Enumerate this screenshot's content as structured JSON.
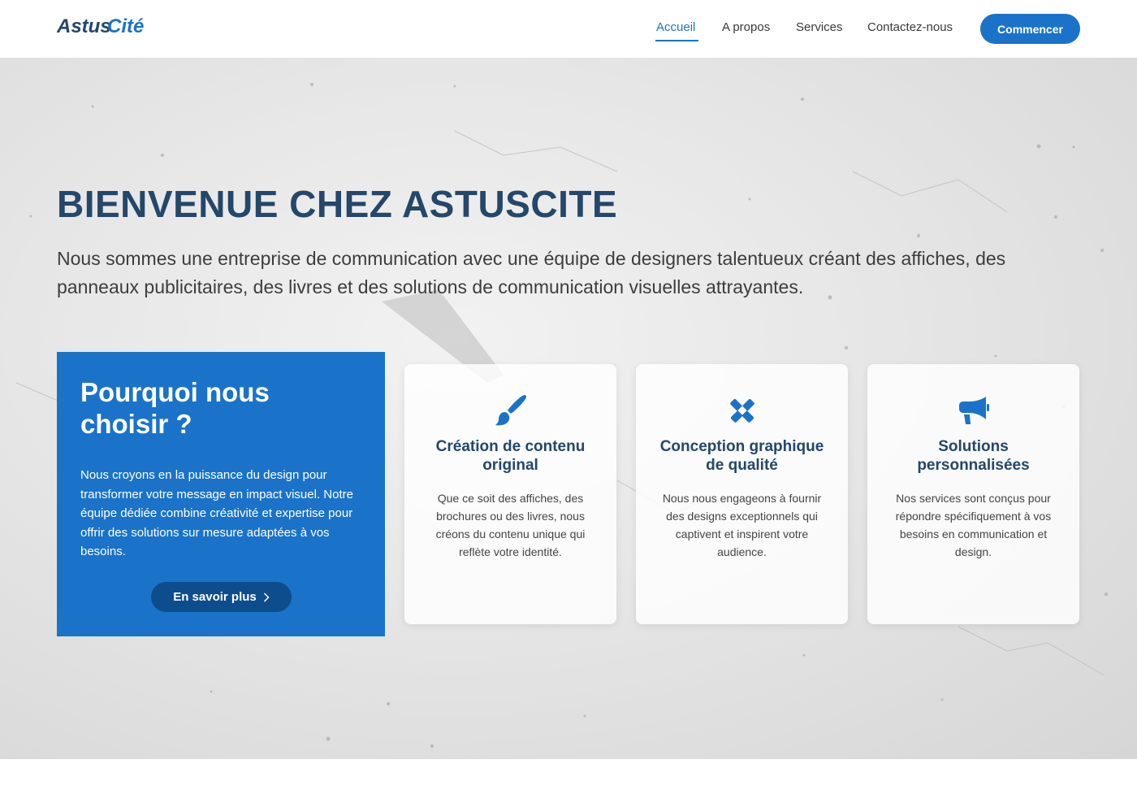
{
  "header": {
    "logo_text": "AstusCité",
    "nav": [
      "Accueil",
      "A propos",
      "Services",
      "Contactez-nous"
    ],
    "active_nav": "Accueil",
    "cta_label": "Commencer"
  },
  "hero": {
    "title": "BIENVENUE CHEZ ASTUSCITE",
    "text": "Nous sommes une entreprise de communication avec une équipe de designers talentueux créant des affiches, des panneaux publicitaires, des livres et des solutions de communication visuelles attrayantes."
  },
  "why": {
    "title": "Pourquoi nous choisir ?",
    "text": "Nous croyons en la puissance du design pour transformer votre message en impact visuel. Notre équipe dédiée combine créativité et expertise pour offrir des solutions sur mesure adaptées à vos besoins.",
    "button_label": "En savoir plus"
  },
  "cards": [
    {
      "icon": "paintbrush-icon",
      "title": "Création de contenu original",
      "text": "Que ce soit des affiches, des brochures ou des livres, nous créons du contenu unique qui reflète votre identité."
    },
    {
      "icon": "pencil-ruler-icon",
      "title": "Conception graphique de qualité",
      "text": "Nous nous engageons à fournir des designs exceptionnels qui captivent et inspirent votre audience."
    },
    {
      "icon": "megaphone-icon",
      "title": "Solutions personnalisées",
      "text": "Nos services sont conçus pour répondre spécifiquement à vos besoins en communication et design."
    }
  ],
  "colors": {
    "primary": "#1a73c8",
    "dark_blue": "#24476a",
    "button_dark": "#0e4d8d"
  }
}
